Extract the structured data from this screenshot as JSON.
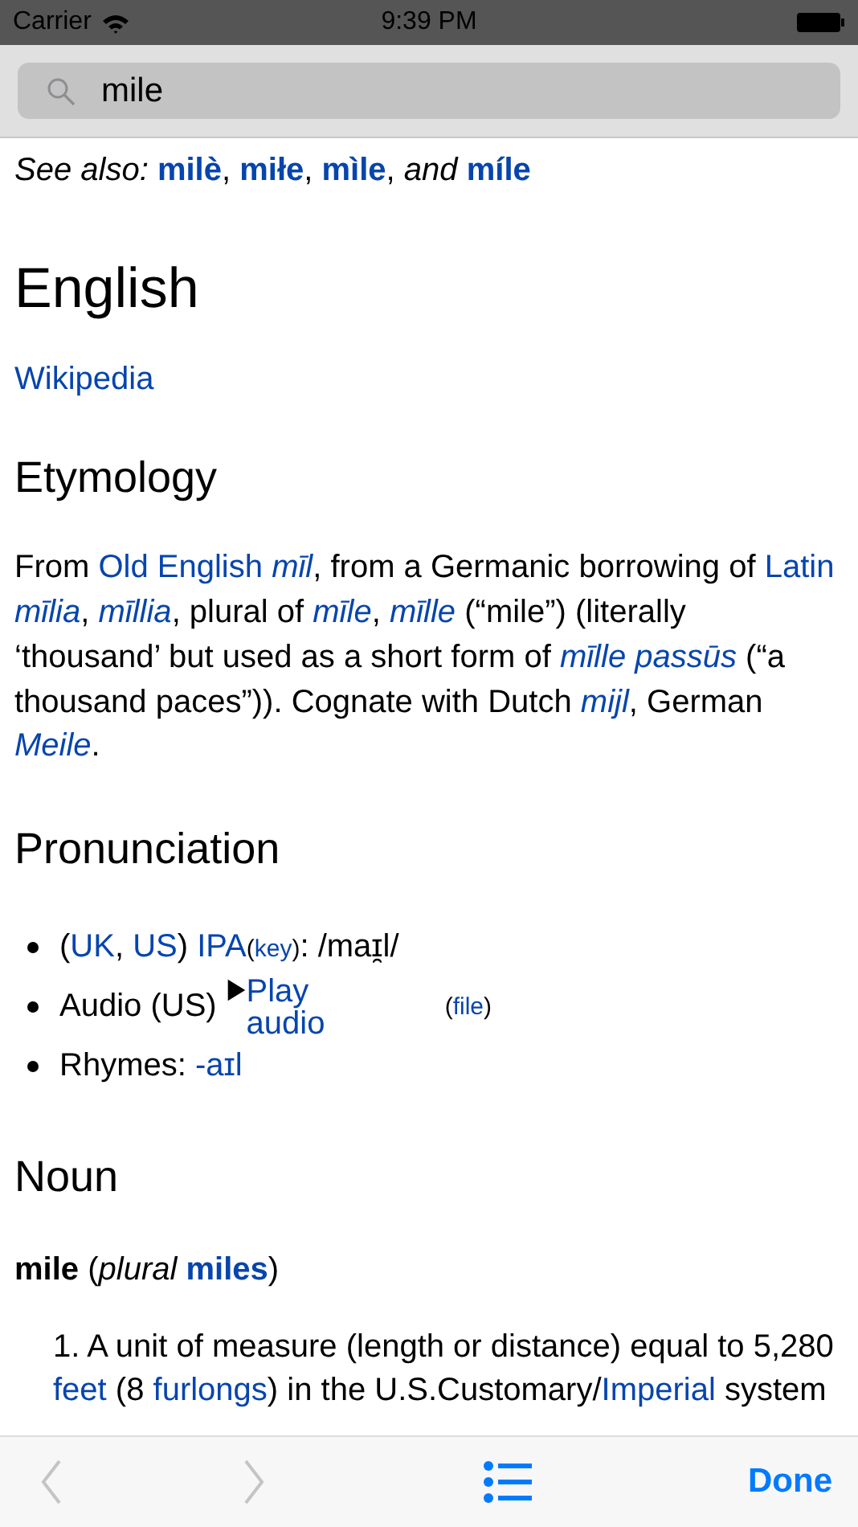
{
  "status_bar": {
    "carrier": "Carrier",
    "time": "9:39 PM"
  },
  "search": {
    "value": "mile"
  },
  "see_also": [
    {
      "kind": "italic_text",
      "text": "See also: "
    },
    {
      "kind": "bold_link",
      "text": "milè"
    },
    {
      "kind": "text",
      "text": ", "
    },
    {
      "kind": "bold_link",
      "text": "miłe"
    },
    {
      "kind": "text",
      "text": ", "
    },
    {
      "kind": "bold_link",
      "text": "mìle"
    },
    {
      "kind": "text",
      "text": ", "
    },
    {
      "kind": "italic_text",
      "text": "and "
    },
    {
      "kind": "bold_link",
      "text": "míle"
    }
  ],
  "language_heading": "English",
  "wikipedia_link": "Wikipedia",
  "etymology": {
    "heading": "Etymology",
    "paragraph": [
      {
        "kind": "text",
        "text": "From "
      },
      {
        "kind": "link",
        "text": "Old English"
      },
      {
        "kind": "italic_link",
        "text": "mīl"
      },
      {
        "kind": "text",
        "text": ", from a Germanic borrowing of "
      },
      {
        "kind": "link",
        "text": "Latin"
      },
      {
        "kind": "italic_link",
        "text": "mīlia"
      },
      {
        "kind": "text",
        "text": ", "
      },
      {
        "kind": "italic_link",
        "text": "mīllia"
      },
      {
        "kind": "text",
        "text": ", plural of "
      },
      {
        "kind": "italic_link",
        "text": "mīle"
      },
      {
        "kind": "text",
        "text": ", "
      },
      {
        "kind": "italic_link",
        "text": "mīlle"
      },
      {
        "kind": "text",
        "text": " (“mile”) (literally ‘thousand’ but used as a short form of "
      },
      {
        "kind": "italic_link",
        "text": "mīlle passūs"
      },
      {
        "kind": "text",
        "text": " (“a thousand paces”)). Cognate with Dutch "
      },
      {
        "kind": "italic_link",
        "text": "mijl"
      },
      {
        "kind": "text",
        "text": ", German "
      },
      {
        "kind": "italic_link",
        "text": "Meile"
      },
      {
        "kind": "text",
        "text": "."
      }
    ]
  },
  "pronunciation": {
    "heading": "Pronunciation",
    "items": [
      {
        "kind": "line",
        "segments": [
          {
            "kind": "text",
            "text": "("
          },
          {
            "kind": "link",
            "text": "UK"
          },
          {
            "kind": "text",
            "text": ", "
          },
          {
            "kind": "link",
            "text": "US"
          },
          {
            "kind": "text",
            "text": ") "
          },
          {
            "kind": "link",
            "text": "IPA"
          },
          {
            "kind": "small_text",
            "text": "("
          },
          {
            "kind": "small_link",
            "text": "key"
          },
          {
            "kind": "small_text",
            "text": ")"
          },
          {
            "kind": "text",
            "text": ": /maɪ̯l/"
          }
        ]
      },
      {
        "kind": "audio",
        "label": "Audio (US)",
        "play": "Play audio",
        "file_open": "(",
        "file": "file",
        "file_close": ")"
      },
      {
        "kind": "line",
        "segments": [
          {
            "kind": "text",
            "text": "Rhymes: "
          },
          {
            "kind": "link",
            "text": "-aɪl"
          }
        ]
      }
    ]
  },
  "noun": {
    "heading": "Noun",
    "headword": [
      {
        "kind": "bold_text",
        "text": "mile"
      },
      {
        "kind": "text",
        "text": " ("
      },
      {
        "kind": "italic_text",
        "text": "plural "
      },
      {
        "kind": "bold_link",
        "text": "miles"
      },
      {
        "kind": "text",
        "text": ")"
      }
    ],
    "senses": [
      {
        "number": "1.",
        "segments": [
          {
            "kind": "text",
            "text": "A unit of measure (length or distance) equal to 5,280 "
          },
          {
            "kind": "link",
            "text": "feet"
          },
          {
            "kind": "text",
            "text": " (8 "
          },
          {
            "kind": "link",
            "text": "furlongs"
          },
          {
            "kind": "text",
            "text": ") in the U.S.Customary/"
          },
          {
            "kind": "link",
            "text": "Imperial"
          },
          {
            "kind": "text",
            "text": " system"
          }
        ]
      }
    ]
  },
  "toolbar": {
    "back_disabled": true,
    "forward_disabled": true,
    "done": "Done"
  }
}
